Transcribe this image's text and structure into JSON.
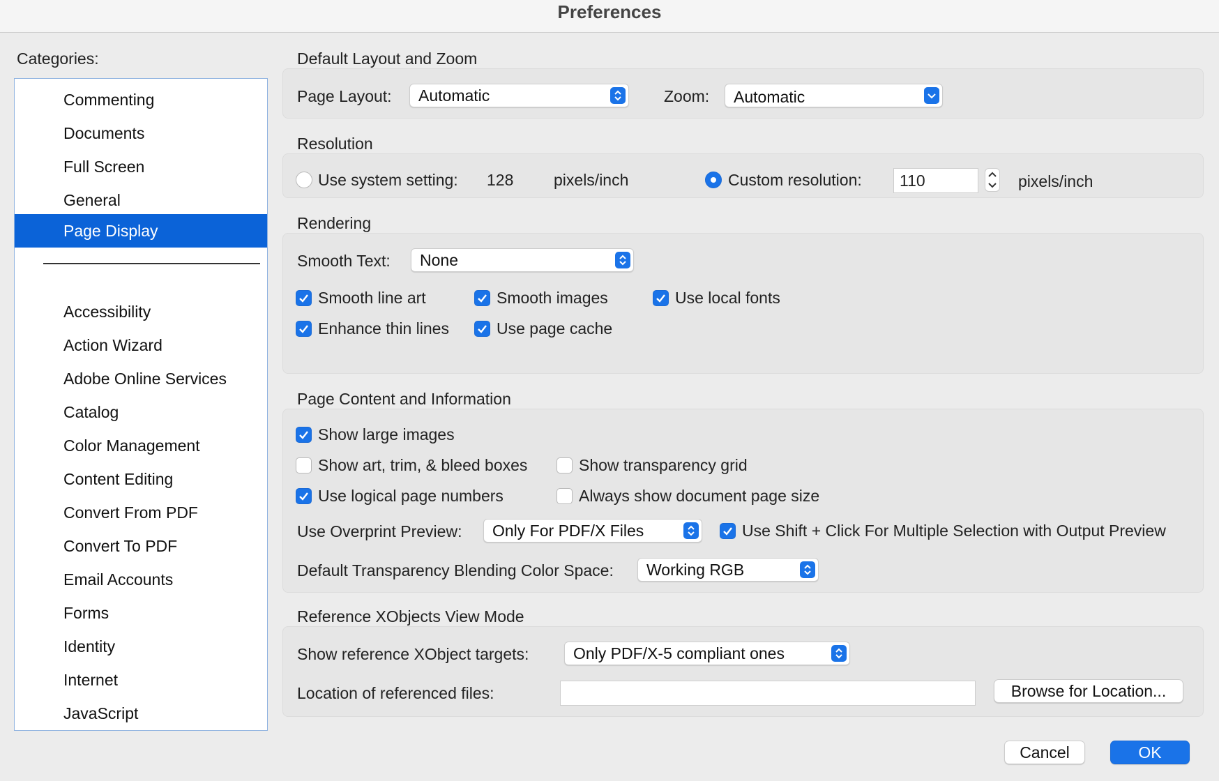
{
  "window": {
    "title": "Preferences"
  },
  "categories": {
    "label": "Categories:",
    "top_items": [
      "Commenting",
      "Documents",
      "Full Screen",
      "General",
      "Page Display"
    ],
    "selected": "Page Display",
    "items": [
      "Accessibility",
      "Action Wizard",
      "Adobe Online Services",
      "Catalog",
      "Color Management",
      "Content Editing",
      "Convert From PDF",
      "Convert To PDF",
      "Email Accounts",
      "Forms",
      "Identity",
      "Internet",
      "JavaScript"
    ]
  },
  "layout_zoom": {
    "heading": "Default Layout and Zoom",
    "page_layout_label": "Page Layout:",
    "page_layout_value": "Automatic",
    "zoom_label": "Zoom:",
    "zoom_value": "Automatic"
  },
  "resolution": {
    "heading": "Resolution",
    "system_label": "Use system setting:",
    "system_value": "128",
    "system_unit": "pixels/inch",
    "custom_label": "Custom resolution:",
    "custom_value": "110",
    "custom_unit": "pixels/inch",
    "selected": "custom"
  },
  "rendering": {
    "heading": "Rendering",
    "smooth_text_label": "Smooth Text:",
    "smooth_text_value": "None",
    "smooth_line_art": "Smooth line art",
    "smooth_images": "Smooth images",
    "use_local_fonts": "Use local fonts",
    "enhance_thin_lines": "Enhance thin lines",
    "use_page_cache": "Use page cache"
  },
  "page_content": {
    "heading": "Page Content and Information",
    "show_large_images": "Show large images",
    "show_boxes": "Show art, trim, & bleed boxes",
    "show_transparency_grid": "Show transparency grid",
    "use_logical_page_numbers": "Use logical page numbers",
    "always_show_page_size": "Always show document page size",
    "overprint_label": "Use Overprint Preview:",
    "overprint_value": "Only For PDF/X Files",
    "shift_click": "Use Shift + Click For Multiple Selection with Output Preview",
    "blending_label": "Default Transparency Blending Color Space:",
    "blending_value": "Working RGB"
  },
  "xobjects": {
    "heading": "Reference XObjects View Mode",
    "targets_label": "Show reference XObject targets:",
    "targets_value": "Only PDF/X-5 compliant ones",
    "location_label": "Location of referenced files:",
    "location_value": "",
    "browse_label": "Browse for Location..."
  },
  "footer": {
    "cancel": "Cancel",
    "ok": "OK"
  },
  "colors": {
    "accent": "#1a73e8",
    "selection": "#0b63d8"
  }
}
